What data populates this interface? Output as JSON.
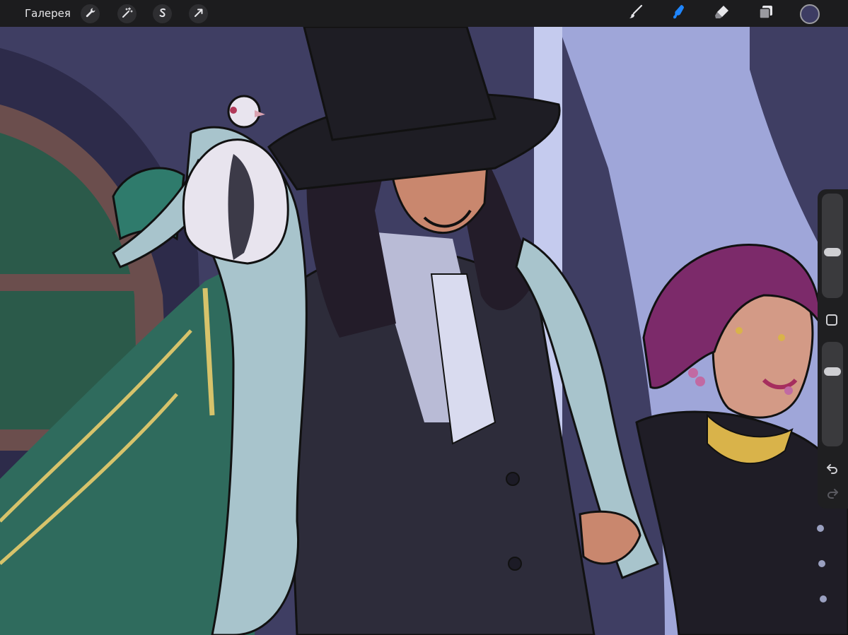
{
  "toolbar": {
    "gallery_label": "Галерея",
    "left_tools": [
      {
        "name": "actions",
        "icon": "wrench-icon"
      },
      {
        "name": "adjustments",
        "icon": "magic-wand-icon"
      },
      {
        "name": "selection",
        "icon": "selection-s-icon"
      },
      {
        "name": "transform",
        "icon": "arrow-cursor-icon"
      }
    ],
    "right_tools": [
      {
        "name": "brush",
        "icon": "brush-icon",
        "active": false
      },
      {
        "name": "smudge",
        "icon": "smudge-icon",
        "active": true
      },
      {
        "name": "eraser",
        "icon": "eraser-icon",
        "active": false
      },
      {
        "name": "layers",
        "icon": "layers-icon",
        "active": false
      }
    ],
    "current_color": "#3d3c63",
    "active_tool_color": "#1f86ff"
  },
  "sidebar": {
    "brush_size_level": 0.43,
    "opacity_level": 0.75,
    "modify_icon": "square-icon",
    "undo_icon": "undo-icon",
    "redo_icon": "redo-icon",
    "redo_enabled": false
  },
  "canvas": {
    "description_icon": "illustration-canvas",
    "colors": {
      "background": "#3f3e63",
      "window_light": "#9fa6d9",
      "cape": "#2f6b5d",
      "fur": "#a8c4cc",
      "suit": "#2d2c3a",
      "hair": "#231c29",
      "skin": "#c9876e",
      "woman_hair": "#7c2a6a",
      "necklace": "#d9b34a"
    }
  }
}
